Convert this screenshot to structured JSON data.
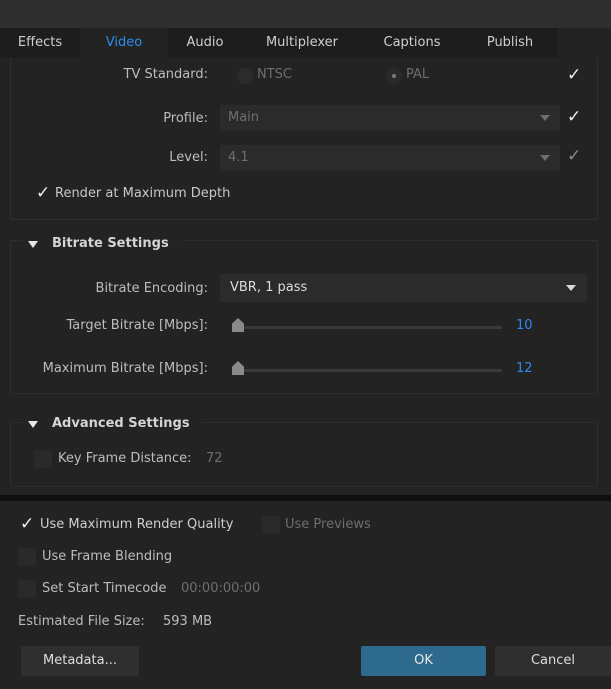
{
  "tabs": [
    "Effects",
    "Video",
    "Audio",
    "Multiplexer",
    "Captions",
    "Publish"
  ],
  "active_tab": "Video",
  "video": {
    "tv_standard_label": "TV Standard:",
    "tv_standard_options": [
      "NTSC",
      "PAL"
    ],
    "tv_standard_selected": "PAL",
    "profile_label": "Profile:",
    "profile_value": "Main",
    "level_label": "Level:",
    "level_value": "4.1",
    "render_max_depth_label": "Render at Maximum Depth",
    "render_max_depth_checked": true
  },
  "bitrate": {
    "section_title": "Bitrate Settings",
    "encoding_label": "Bitrate Encoding:",
    "encoding_value": "VBR, 1 pass",
    "target_label": "Target Bitrate [Mbps]:",
    "target_value": "10",
    "max_label": "Maximum Bitrate [Mbps]:",
    "max_value": "12"
  },
  "advanced": {
    "section_title": "Advanced Settings",
    "key_frame_label": "Key Frame Distance:",
    "key_frame_value": "72",
    "key_frame_checked": false
  },
  "bottom": {
    "use_max_quality_label": "Use Maximum Render Quality",
    "use_max_quality_checked": true,
    "use_previews_label": "Use Previews",
    "use_previews_checked": false,
    "frame_blending_label": "Use Frame Blending",
    "frame_blending_checked": false,
    "start_timecode_label": "Set Start Timecode",
    "start_timecode_value": "00:00:00:00",
    "start_timecode_checked": false,
    "estimated_size_label": "Estimated File Size:",
    "estimated_size_value": "593 MB"
  },
  "buttons": {
    "metadata": "Metadata...",
    "ok": "OK",
    "cancel": "Cancel"
  },
  "colors": {
    "accent": "#2d8ceb",
    "ok_button": "#2e6a8e",
    "background": "#232323"
  }
}
